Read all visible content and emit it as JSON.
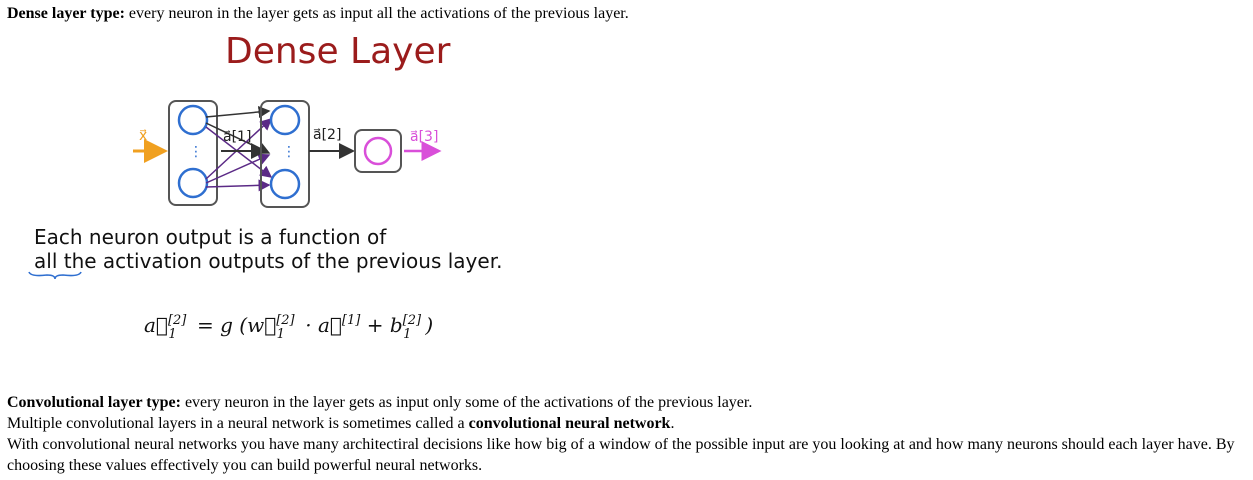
{
  "intro": {
    "term": "Dense layer type:",
    "text": " every neuron in the layer gets as input all the activations of the previous layer."
  },
  "slide": {
    "title": "Dense Layer",
    "labels": {
      "x": "x⃗",
      "dots1": "⋮",
      "dots2": "⋮",
      "a1": "a⃗[1]",
      "a2": "a⃗[2]",
      "a3": "a⃗[3]"
    },
    "caption_line1": "Each neuron output is a function of",
    "caption_line2_emph": "all",
    "caption_line2_rest": " the activation outputs of the previous layer.",
    "formula": {
      "lhs": "a⃗",
      "lhs_sup": "[2]",
      "lhs_sub": "1",
      "eq": " = g (",
      "w": "w⃗",
      "w_sup": "[2]",
      "w_sub": "1",
      "dot": " · ",
      "a": "a⃗",
      "a_sup": "[1]",
      "plus": " + ",
      "b": "b",
      "b_sup": "[2]",
      "b_sub": "1",
      "close": ")"
    },
    "colors": {
      "title": "#9b1c1c",
      "neuron_blue": "#2f6fd0",
      "input_orange": "#f0a020",
      "output_magenta": "#d94fd9",
      "arrow_purple": "#5b2a86"
    }
  },
  "conv": {
    "term": "Convolutional layer type:",
    "text": " every neuron in the layer gets as input only some of the activations of the previous layer."
  },
  "multi": {
    "text": "Multiple convolutional layers in a neural network is sometimes called a ",
    "bold": "convolutional neural network",
    "end": "."
  },
  "decisions": {
    "text": "With convolutional neural networks you have many architectiral decisions like how big of a window of the possible input are you looking at and how many neurons should each layer have. By choosing these values effectively you can build powerful neural networks."
  }
}
